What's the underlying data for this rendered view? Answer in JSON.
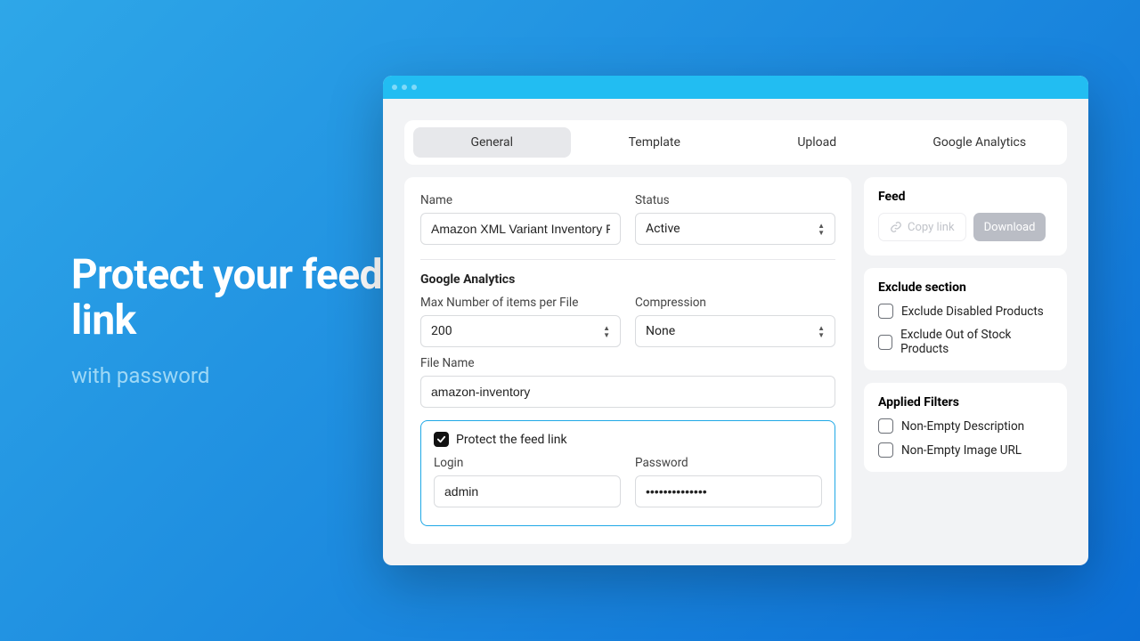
{
  "promo": {
    "headline": "Protect your feed link",
    "subline": "with password"
  },
  "tabs": [
    "General",
    "Template",
    "Upload",
    "Google Analytics"
  ],
  "activeTab": 0,
  "form": {
    "name": {
      "label": "Name",
      "value": "Amazon XML Variant Inventory Feed"
    },
    "status": {
      "label": "Status",
      "value": "Active"
    },
    "ga_section_title": "Google Analytics",
    "max_items": {
      "label": "Max Number of items per File",
      "value": "200"
    },
    "compression": {
      "label": "Compression",
      "value": "None"
    },
    "file_name": {
      "label": "File Name",
      "value": "amazon-inventory"
    },
    "protect": {
      "checkbox_label": "Protect the feed link",
      "checked": true,
      "login": {
        "label": "Login",
        "value": "admin"
      },
      "password": {
        "label": "Password",
        "value": "••••••••••••••"
      }
    }
  },
  "side": {
    "feed": {
      "title": "Feed",
      "copy": "Copy link",
      "download": "Download"
    },
    "exclude": {
      "title": "Exclude section",
      "items": [
        {
          "label": "Exclude Disabled Products",
          "checked": false
        },
        {
          "label": "Exclude Out of Stock Products",
          "checked": false
        }
      ]
    },
    "filters": {
      "title": "Applied Filters",
      "items": [
        {
          "label": "Non-Empty Description",
          "checked": false
        },
        {
          "label": "Non-Empty Image URL",
          "checked": false
        }
      ]
    }
  }
}
